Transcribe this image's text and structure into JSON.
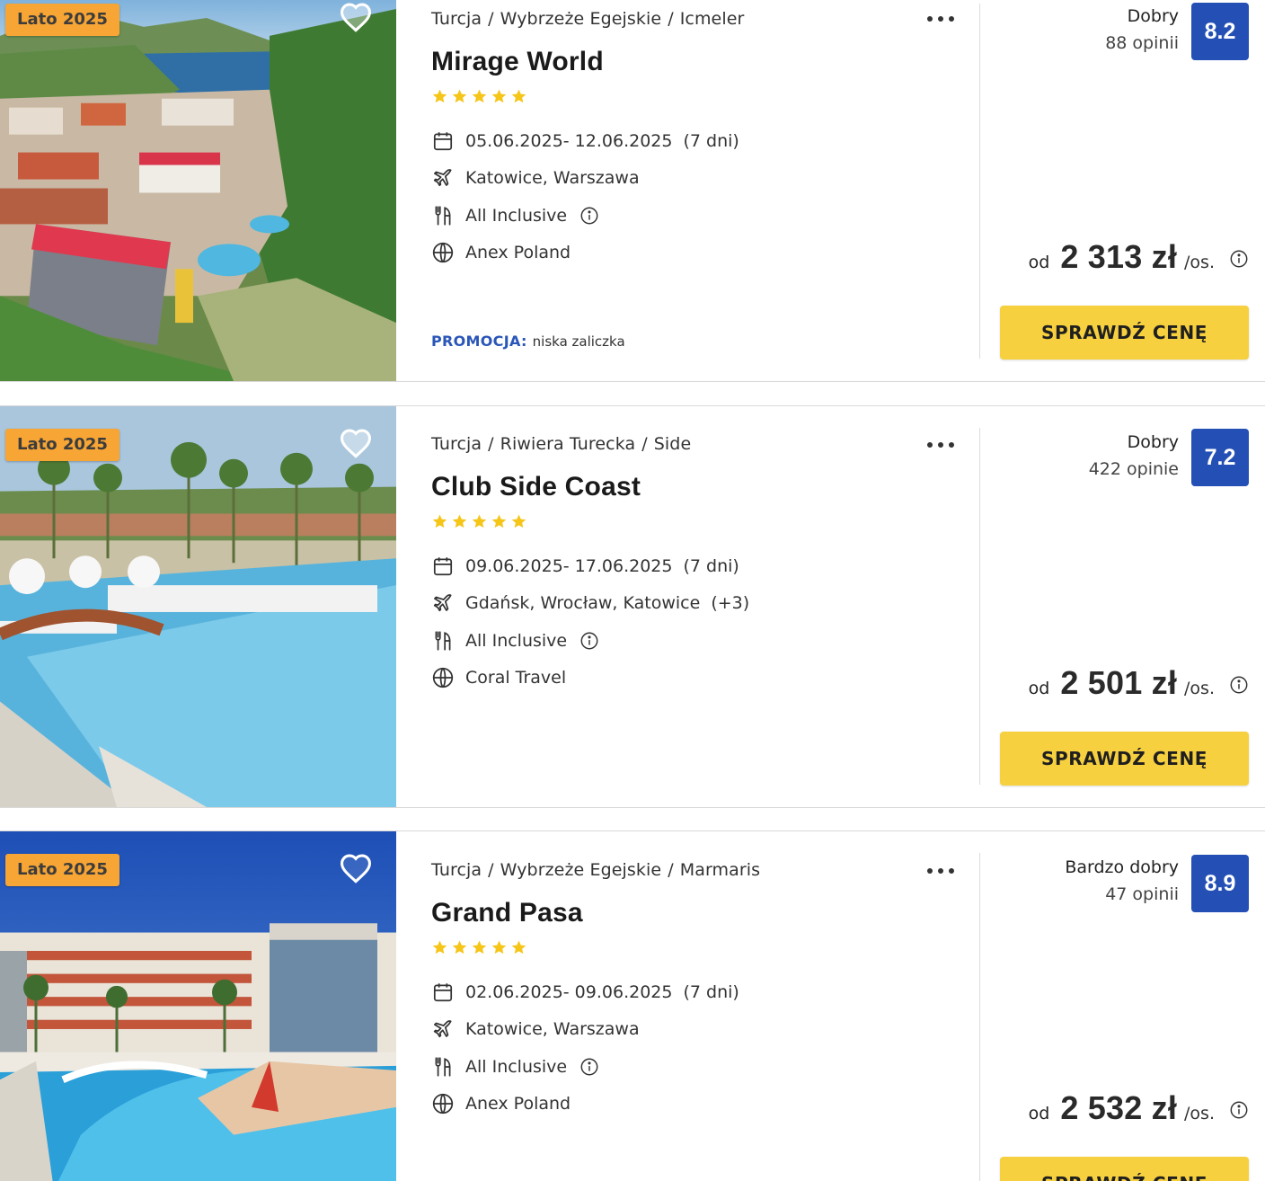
{
  "offers": [
    {
      "badge": "Lato 2025",
      "breadcrumb": [
        "Turcja",
        "Wybrzeże Egejskie",
        "Icmeler"
      ],
      "name": "Mirage World",
      "stars": 5,
      "dates": "05.06.2025- 12.06.2025",
      "duration": "(7 dni)",
      "departures": "Katowice, Warszawa",
      "departures_extra": "",
      "board": "All Inclusive",
      "operator": "Anex Poland",
      "promo_label": "PROMOCJA:",
      "promo_text": "niska zaliczka",
      "rating_label": "Dobry",
      "reviews": "88 opinii",
      "score": "8.2",
      "price_prefix": "od",
      "price": "2 313 zł",
      "price_unit": "/os.",
      "cta": "SPRAWDŹ CENĘ"
    },
    {
      "badge": "Lato 2025",
      "breadcrumb": [
        "Turcja",
        "Riwiera Turecka",
        "Side"
      ],
      "name": "Club Side Coast",
      "stars": 5,
      "dates": "09.06.2025- 17.06.2025",
      "duration": "(7 dni)",
      "departures": "Gdańsk, Wrocław, Katowice",
      "departures_extra": "(+3)",
      "board": "All Inclusive",
      "operator": "Coral Travel",
      "rating_label": "Dobry",
      "reviews": "422 opinie",
      "score": "7.2",
      "price_prefix": "od",
      "price": "2 501 zł",
      "price_unit": "/os.",
      "cta": "SPRAWDŹ CENĘ"
    },
    {
      "badge": "Lato 2025",
      "breadcrumb": [
        "Turcja",
        "Wybrzeże Egejskie",
        "Marmaris"
      ],
      "name": "Grand Pasa",
      "stars": 5,
      "dates": "02.06.2025- 09.06.2025",
      "duration": "(7 dni)",
      "departures": "Katowice, Warszawa",
      "departures_extra": "",
      "board": "All Inclusive",
      "operator": "Anex Poland",
      "rating_label": "Bardzo dobry",
      "reviews": "47 opinii",
      "score": "8.9",
      "price_prefix": "od",
      "price": "2 532 zł",
      "price_unit": "/os.",
      "cta": "SPRAWDŹ CENĘ"
    }
  ],
  "colors": {
    "badge": "#f7a534",
    "score": "#2450b5",
    "cta": "#f6d03f",
    "promo": "#2a56b8",
    "star": "#f5c518"
  },
  "icons": {
    "favorite": "heart-icon",
    "more": "more-dots-icon",
    "dates": "calendar-icon",
    "departures": "plane-icon",
    "board": "cutlery-icon",
    "operator": "globe-icon",
    "info": "info-icon"
  }
}
